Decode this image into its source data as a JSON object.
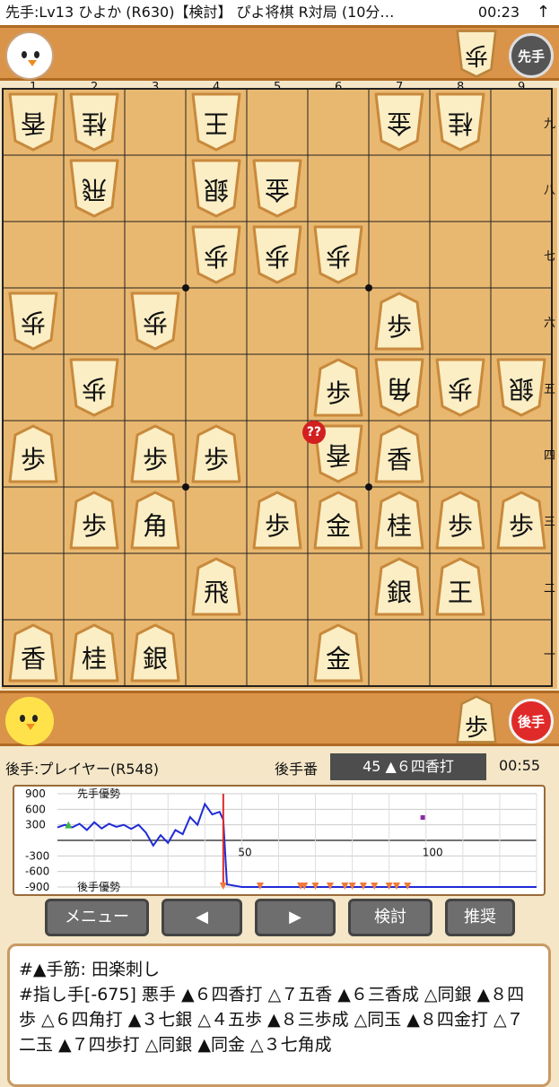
{
  "titlebar": {
    "title": "先手:Lv13 ひよか (R630)【検討】 ぴよ将棋 R対局 (10分…",
    "time": "00:23",
    "arrow": "↑"
  },
  "top_stand": {
    "avatar": "white-chick-icon",
    "hand_piece": "歩",
    "badge": "先手"
  },
  "bottom_stand": {
    "avatar": "yellow-chick-icon",
    "hand_piece": "歩",
    "badge": "後手"
  },
  "board": {
    "col_labels": [
      "1",
      "2",
      "3",
      "4",
      "5",
      "6",
      "7",
      "8",
      "9"
    ],
    "row_labels": [
      "九",
      "八",
      "七",
      "六",
      "五",
      "四",
      "三",
      "二",
      "一"
    ],
    "pieces": [
      {
        "row": 0,
        "col": 0,
        "text": "香",
        "flip": true
      },
      {
        "row": 0,
        "col": 1,
        "text": "桂",
        "flip": true
      },
      {
        "row": 0,
        "col": 3,
        "text": "王",
        "flip": true
      },
      {
        "row": 0,
        "col": 6,
        "text": "金",
        "flip": true
      },
      {
        "row": 0,
        "col": 7,
        "text": "桂",
        "flip": true
      },
      {
        "row": 1,
        "col": 1,
        "text": "飛",
        "flip": true
      },
      {
        "row": 1,
        "col": 3,
        "text": "銀",
        "flip": true
      },
      {
        "row": 1,
        "col": 4,
        "text": "金",
        "flip": true
      },
      {
        "row": 2,
        "col": 3,
        "text": "歩",
        "flip": true
      },
      {
        "row": 2,
        "col": 4,
        "text": "歩",
        "flip": true
      },
      {
        "row": 2,
        "col": 5,
        "text": "歩",
        "flip": true
      },
      {
        "row": 3,
        "col": 0,
        "text": "歩",
        "flip": true
      },
      {
        "row": 3,
        "col": 2,
        "text": "歩",
        "flip": true
      },
      {
        "row": 3,
        "col": 6,
        "text": "歩",
        "flip": false
      },
      {
        "row": 4,
        "col": 1,
        "text": "歩",
        "flip": true
      },
      {
        "row": 4,
        "col": 5,
        "text": "歩",
        "flip": false
      },
      {
        "row": 4,
        "col": 6,
        "text": "角",
        "flip": true
      },
      {
        "row": 4,
        "col": 7,
        "text": "歩",
        "flip": true
      },
      {
        "row": 4,
        "col": 8,
        "text": "銀",
        "flip": true
      },
      {
        "row": 5,
        "col": 0,
        "text": "歩",
        "flip": false
      },
      {
        "row": 5,
        "col": 2,
        "text": "歩",
        "flip": false
      },
      {
        "row": 5,
        "col": 3,
        "text": "歩",
        "flip": false
      },
      {
        "row": 5,
        "col": 5,
        "text": "香",
        "flip": true
      },
      {
        "row": 5,
        "col": 6,
        "text": "香",
        "flip": false
      },
      {
        "row": 6,
        "col": 1,
        "text": "歩",
        "flip": false
      },
      {
        "row": 6,
        "col": 2,
        "text": "角",
        "flip": false
      },
      {
        "row": 6,
        "col": 4,
        "text": "歩",
        "flip": false
      },
      {
        "row": 6,
        "col": 5,
        "text": "金",
        "flip": false
      },
      {
        "row": 6,
        "col": 6,
        "text": "桂",
        "flip": false
      },
      {
        "row": 6,
        "col": 7,
        "text": "歩",
        "flip": false
      },
      {
        "row": 6,
        "col": 8,
        "text": "歩",
        "flip": false
      },
      {
        "row": 7,
        "col": 3,
        "text": "飛",
        "flip": false
      },
      {
        "row": 7,
        "col": 6,
        "text": "銀",
        "flip": false
      },
      {
        "row": 7,
        "col": 7,
        "text": "王",
        "flip": false
      },
      {
        "row": 8,
        "col": 0,
        "text": "香",
        "flip": false
      },
      {
        "row": 8,
        "col": 1,
        "text": "桂",
        "flip": false
      },
      {
        "row": 8,
        "col": 2,
        "text": "銀",
        "flip": false
      },
      {
        "row": 8,
        "col": 5,
        "text": "金",
        "flip": false
      }
    ],
    "marker": {
      "row": 5,
      "col": 5,
      "text": "??"
    }
  },
  "status": {
    "gote_player": "後手:プレイヤー(R548)",
    "turn": "後手番",
    "move": "45 ▲６四香打",
    "clock": "00:55"
  },
  "graph": {
    "y_labels": [
      "900",
      "600",
      "300",
      "-300",
      "-600",
      "-900"
    ],
    "top_label": "先手優勢",
    "bottom_label": "後手優勢",
    "x_labels": [
      "50",
      "100"
    ]
  },
  "chart_data": {
    "type": "line",
    "title": "",
    "xlabel": "",
    "ylabel": "",
    "ylim": [
      -900,
      900
    ],
    "xlim": [
      0,
      130
    ],
    "current_move": 45,
    "series": [
      {
        "x": [
          0,
          2,
          4,
          6,
          8,
          10,
          12,
          14,
          16,
          18,
          20,
          22,
          24,
          26,
          28,
          30,
          32,
          34,
          36,
          38,
          40,
          42,
          44,
          45,
          46,
          50,
          60,
          70,
          80,
          90,
          100,
          110,
          120,
          130
        ],
        "values": [
          250,
          300,
          250,
          320,
          200,
          350,
          230,
          320,
          260,
          300,
          220,
          300,
          150,
          -100,
          100,
          -50,
          200,
          120,
          450,
          300,
          700,
          500,
          550,
          400,
          -850,
          -900,
          -900,
          -900,
          -900,
          -900,
          -900,
          -900,
          -900,
          -900
        ]
      }
    ]
  },
  "buttons": {
    "menu": "メニュー",
    "prev": "◀",
    "next": "▶",
    "review": "検討",
    "recommend": "推奨"
  },
  "comment": {
    "line1": "#▲手筋: 田楽刺し",
    "line2": "#指し手[-675] 悪手 ▲６四香打 △７五香 ▲６三香成 △同銀 ▲８四歩 △６四角打 ▲３七銀 △４五歩 ▲８三歩成 △同玉 ▲８四金打 △７二玉 ▲７四歩打 △同銀 ▲同金 △３七角成"
  },
  "colors": {
    "board": "#e9b870",
    "stand": "#d9944a",
    "accent_red": "#e02a2a",
    "graph_line": "#1f2bd6"
  }
}
